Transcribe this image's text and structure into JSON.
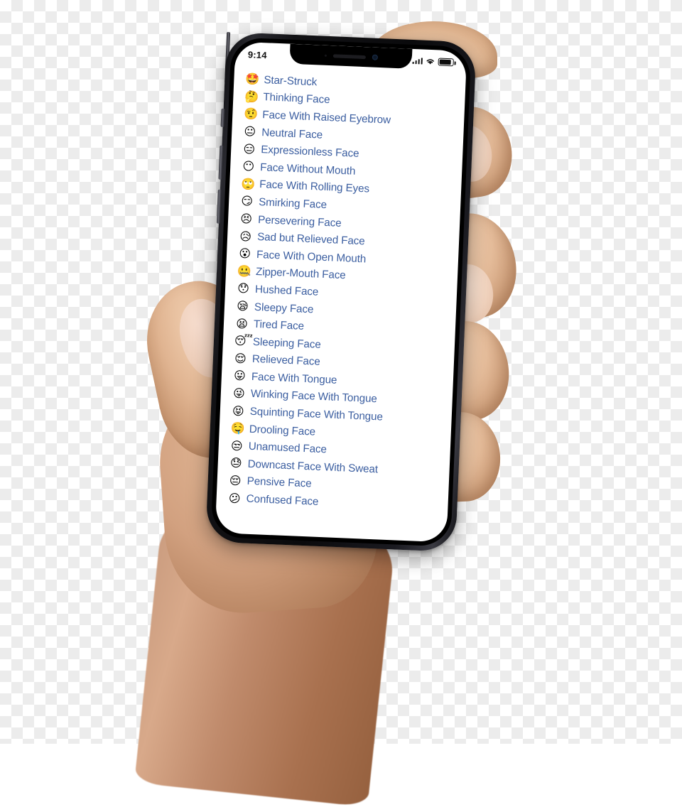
{
  "device": {
    "name": "iPhone X",
    "frame_color": "#121215",
    "screen_background": "#ffffff"
  },
  "status_bar": {
    "time": "9:14",
    "signal_icon": "cellular-signal-icon",
    "signal_bars": 4,
    "wifi_icon": "wifi-icon",
    "battery_icon": "battery-icon",
    "battery_level_percent": 85
  },
  "notch": {
    "speaker_icon": "earpiece-speaker-icon",
    "camera_icon": "front-camera-icon",
    "sensor_icon": "proximity-sensor-icon"
  },
  "side_buttons": {
    "silent_switch": "silent-switch",
    "volume_up": "volume-up-button",
    "volume_down": "volume-down-button",
    "power": "power-button"
  },
  "theme": {
    "link_color": "#3b5ea0",
    "text_color": "#111111"
  },
  "list": {
    "items": [
      {
        "emoji": "🤩",
        "icon_name": "star-struck-emoji",
        "label": "Star-Struck"
      },
      {
        "emoji": "🤔",
        "icon_name": "thinking-face-emoji",
        "label": "Thinking Face"
      },
      {
        "emoji": "🤨",
        "icon_name": "face-with-raised-eyebrow-emoji",
        "label": "Face With Raised Eyebrow"
      },
      {
        "emoji": "😐",
        "icon_name": "neutral-face-emoji",
        "label": "Neutral Face"
      },
      {
        "emoji": "😑",
        "icon_name": "expressionless-face-emoji",
        "label": "Expressionless Face"
      },
      {
        "emoji": "😶",
        "icon_name": "face-without-mouth-emoji",
        "label": "Face Without Mouth"
      },
      {
        "emoji": "🙄",
        "icon_name": "face-with-rolling-eyes-emoji",
        "label": "Face With Rolling Eyes"
      },
      {
        "emoji": "😏",
        "icon_name": "smirking-face-emoji",
        "label": "Smirking Face"
      },
      {
        "emoji": "😣",
        "icon_name": "persevering-face-emoji",
        "label": "Persevering Face"
      },
      {
        "emoji": "😥",
        "icon_name": "sad-but-relieved-face-emoji",
        "label": "Sad but Relieved Face"
      },
      {
        "emoji": "😮",
        "icon_name": "face-with-open-mouth-emoji",
        "label": "Face With Open Mouth"
      },
      {
        "emoji": "🤐",
        "icon_name": "zipper-mouth-face-emoji",
        "label": "Zipper-Mouth Face"
      },
      {
        "emoji": "😯",
        "icon_name": "hushed-face-emoji",
        "label": "Hushed Face"
      },
      {
        "emoji": "😪",
        "icon_name": "sleepy-face-emoji",
        "label": "Sleepy Face"
      },
      {
        "emoji": "😫",
        "icon_name": "tired-face-emoji",
        "label": "Tired Face"
      },
      {
        "emoji": "😴",
        "icon_name": "sleeping-face-emoji",
        "label": "Sleeping Face"
      },
      {
        "emoji": "😌",
        "icon_name": "relieved-face-emoji",
        "label": "Relieved Face"
      },
      {
        "emoji": "😛",
        "icon_name": "face-with-tongue-emoji",
        "label": "Face With Tongue"
      },
      {
        "emoji": "😜",
        "icon_name": "winking-face-with-tongue-emoji",
        "label": "Winking Face With Tongue"
      },
      {
        "emoji": "😝",
        "icon_name": "squinting-face-with-tongue-emoji",
        "label": "Squinting Face With Tongue"
      },
      {
        "emoji": "🤤",
        "icon_name": "drooling-face-emoji",
        "label": "Drooling Face"
      },
      {
        "emoji": "😒",
        "icon_name": "unamused-face-emoji",
        "label": "Unamused Face"
      },
      {
        "emoji": "😓",
        "icon_name": "downcast-face-with-sweat-emoji",
        "label": "Downcast Face With Sweat"
      },
      {
        "emoji": "😔",
        "icon_name": "pensive-face-emoji",
        "label": "Pensive Face"
      },
      {
        "emoji": "😕",
        "icon_name": "confused-face-emoji",
        "label": "Confused Face"
      }
    ]
  }
}
